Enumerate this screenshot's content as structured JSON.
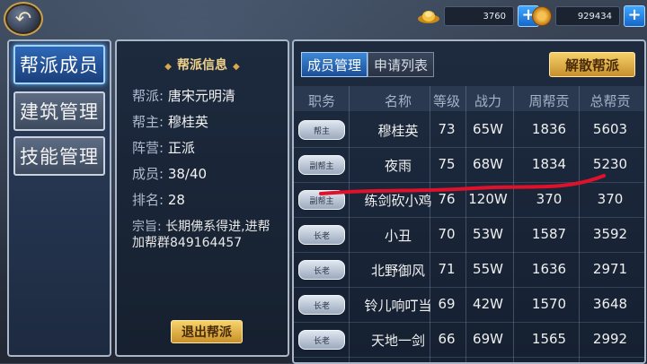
{
  "top": {
    "gold": "3760",
    "copper": "929434"
  },
  "menu": [
    {
      "label": "帮派成员"
    },
    {
      "label": "建筑管理"
    },
    {
      "label": "技能管理"
    }
  ],
  "info": {
    "title": "帮派信息",
    "rows": [
      {
        "k": "帮派:",
        "v": "唐宋元明清"
      },
      {
        "k": "帮主:",
        "v": "穆桂英"
      },
      {
        "k": "阵营:",
        "v": "正派"
      },
      {
        "k": "成员:",
        "v": "38/40"
      },
      {
        "k": "排名:",
        "v": "28"
      }
    ],
    "motto_key": "宗旨:",
    "motto_val": "长期佛系得进,进帮加帮群849164457",
    "exit_label": "退出帮派"
  },
  "panel": {
    "tabs": [
      "成员管理",
      "申请列表"
    ],
    "dissolve_label": "解散帮派",
    "headers": [
      "职务",
      "名称",
      "等级",
      "战力",
      "周帮贡",
      "总帮贡"
    ],
    "rows": [
      {
        "role": "帮主",
        "name": "穆桂英",
        "level": "73",
        "power": "65W",
        "weekly": "1836",
        "total": "5603"
      },
      {
        "role": "副帮主",
        "name": "夜雨",
        "level": "75",
        "power": "68W",
        "weekly": "1834",
        "total": "5230"
      },
      {
        "role": "副帮主",
        "name": "练剑砍小鸡",
        "level": "76",
        "power": "120W",
        "weekly": "370",
        "total": "370"
      },
      {
        "role": "长老",
        "name": "小丑",
        "level": "70",
        "power": "53W",
        "weekly": "1587",
        "total": "3592"
      },
      {
        "role": "长老",
        "name": "北野御风",
        "level": "71",
        "power": "55W",
        "weekly": "1636",
        "total": "2971"
      },
      {
        "role": "长老",
        "name": "铃儿响叮当",
        "level": "69",
        "power": "42W",
        "weekly": "1570",
        "total": "3648"
      },
      {
        "role": "长老",
        "name": "天地一剑",
        "level": "66",
        "power": "69W",
        "weekly": "1565",
        "total": "2992"
      }
    ]
  }
}
